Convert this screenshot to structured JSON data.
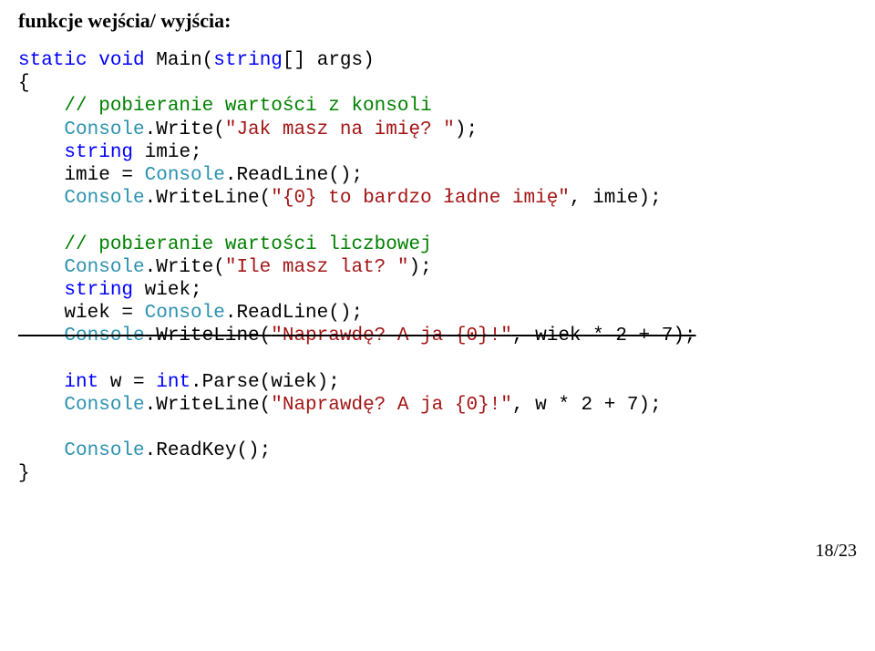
{
  "heading": "funkcje wejścia/ wyjścia:",
  "code": {
    "l1a": "static",
    "l1b": "void",
    "l1c": " Main(",
    "l1d": "string",
    "l1e": "[] args)",
    "l2": "{",
    "l3": "    // pobieranie wartości z konsoli",
    "l4a": "    Console",
    "l4b": ".Write(",
    "l4c": "\"Jak masz na imię? \"",
    "l4d": ");",
    "l5a": "    string",
    "l5b": " imie;",
    "l6a": "    imie = ",
    "l6b": "Console",
    "l6c": ".ReadLine();",
    "l7a": "    Console",
    "l7b": ".WriteLine(",
    "l7c": "\"{0} to bardzo ładne imię\"",
    "l7d": ", imie);",
    "l8": " ",
    "l9": "    // pobieranie wartości liczbowej",
    "l10a": "    Console",
    "l10b": ".Write(",
    "l10c": "\"Ile masz lat? \"",
    "l10d": ");",
    "l11a": "    string",
    "l11b": " wiek;",
    "l12a": "    wiek = ",
    "l12b": "Console",
    "l12c": ".ReadLine();",
    "l13a": "    Console",
    "l13b": ".WriteLine(",
    "l13c": "\"Naprawdę? A ja {0}!\"",
    "l13d": ", wiek * 2 + 7);",
    "l14": " ",
    "l15a": "    int",
    "l15b": " w = ",
    "l15c": "int",
    "l15d": ".Parse(wiek);",
    "l16a": "    Console",
    "l16b": ".WriteLine(",
    "l16c": "\"Naprawdę? A ja {0}!\"",
    "l16d": ", w * 2 + 7);",
    "l17": " ",
    "l18a": "    Console",
    "l18b": ".ReadKey();",
    "l19": "}"
  },
  "pagenum": "18/23"
}
